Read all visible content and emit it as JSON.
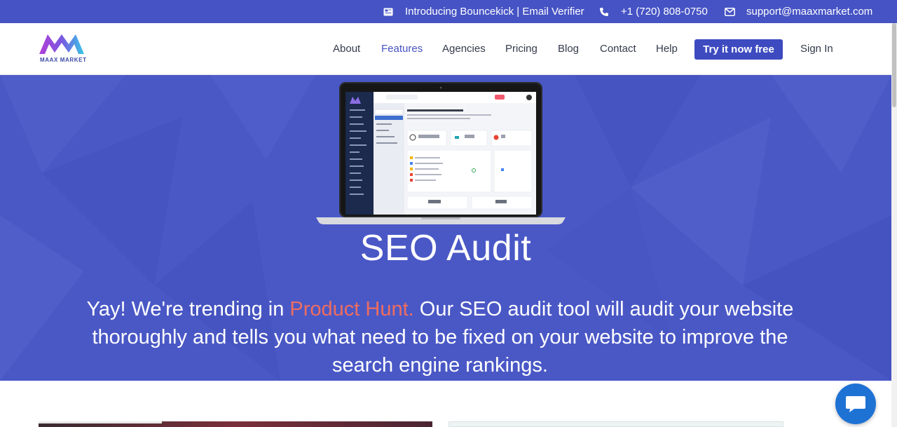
{
  "topbar": {
    "promo": "Introducing Bouncekick | Email Verifier",
    "phone": "+1 (720) 808-0750",
    "email": "support@maaxmarket.com",
    "icons": [
      "newspaper-icon",
      "phone-icon",
      "mail-icon"
    ]
  },
  "brand": {
    "name": "MAAX MARKET"
  },
  "nav": {
    "items": [
      {
        "label": "About"
      },
      {
        "label": "Features",
        "active": true
      },
      {
        "label": "Agencies"
      },
      {
        "label": "Pricing"
      },
      {
        "label": "Blog"
      },
      {
        "label": "Contact"
      },
      {
        "label": "Help"
      }
    ],
    "cta": "Try it now free",
    "signin": "Sign In"
  },
  "hero": {
    "title": "SEO Audit",
    "desc_before": "Yay! We're trending in ",
    "desc_link": "Product Hunt.",
    "desc_after": " Our SEO audit tool will audit your website thoroughly and tells you what need to be fixed on your website to improve the search engine rankings."
  },
  "colors": {
    "topbar": "#4653c4",
    "hero": "#4a58c6",
    "cta": "#3d4ac0",
    "highlight": "#ee6d5f",
    "chat": "#1e72d4"
  }
}
